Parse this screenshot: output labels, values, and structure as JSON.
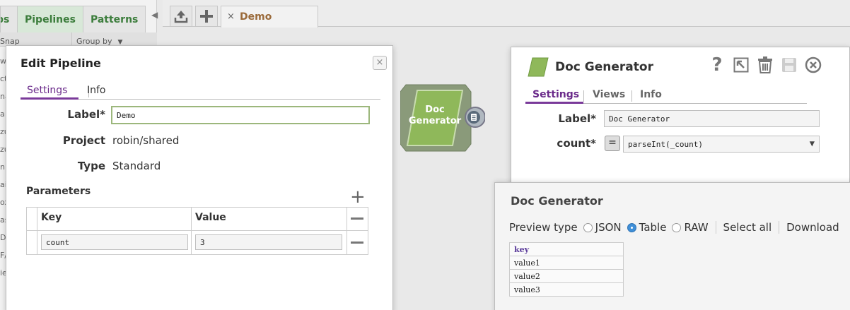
{
  "palette": {
    "tabs": [
      "ps",
      "Pipelines",
      "Patterns"
    ],
    "snap_label": "Snap",
    "group_by": "Group by",
    "list_fragments": [
      "w",
      "ct",
      "na",
      "a",
      "zu",
      "zu",
      "n",
      "ai",
      "ox",
      "as",
      "Di",
      "F/",
      "ie"
    ]
  },
  "toolbar": {
    "open_tab_label": "Demo",
    "close_tab": "×"
  },
  "edit_pipeline": {
    "title": "Edit Pipeline",
    "close": "×",
    "tabs": [
      "Settings",
      "Info"
    ],
    "label_caption": "Label*",
    "label_value": "Demo",
    "project_caption": "Project",
    "project_value": "robin/shared",
    "type_caption": "Type",
    "type_value": "Standard",
    "parameters_title": "Parameters",
    "columns": [
      "Key",
      "Value"
    ],
    "rows": [
      {
        "key": "count",
        "value": "3"
      }
    ]
  },
  "canvas": {
    "snap_name_line1": "Doc",
    "snap_name_line2": "Generator"
  },
  "snap_settings": {
    "title": "Doc Generator",
    "tabs": [
      "Settings",
      "Views",
      "Info"
    ],
    "label_caption": "Label*",
    "label_value": "Doc Generator",
    "count_caption": "count*",
    "expr_toggle": "=",
    "count_value": "parseInt(_count)"
  },
  "preview": {
    "title": "Doc Generator",
    "type_label": "Preview type",
    "options": [
      "JSON",
      "Table",
      "RAW"
    ],
    "selected": "Table",
    "select_all": "Select all",
    "download": "Download",
    "table_header": "key",
    "table_rows": [
      "value1",
      "value2",
      "value3"
    ]
  },
  "colors": {
    "accent_purple": "#6a2a8a",
    "snap_green": "#8fb85a",
    "palette_tab_green": "#3c7d3c"
  }
}
